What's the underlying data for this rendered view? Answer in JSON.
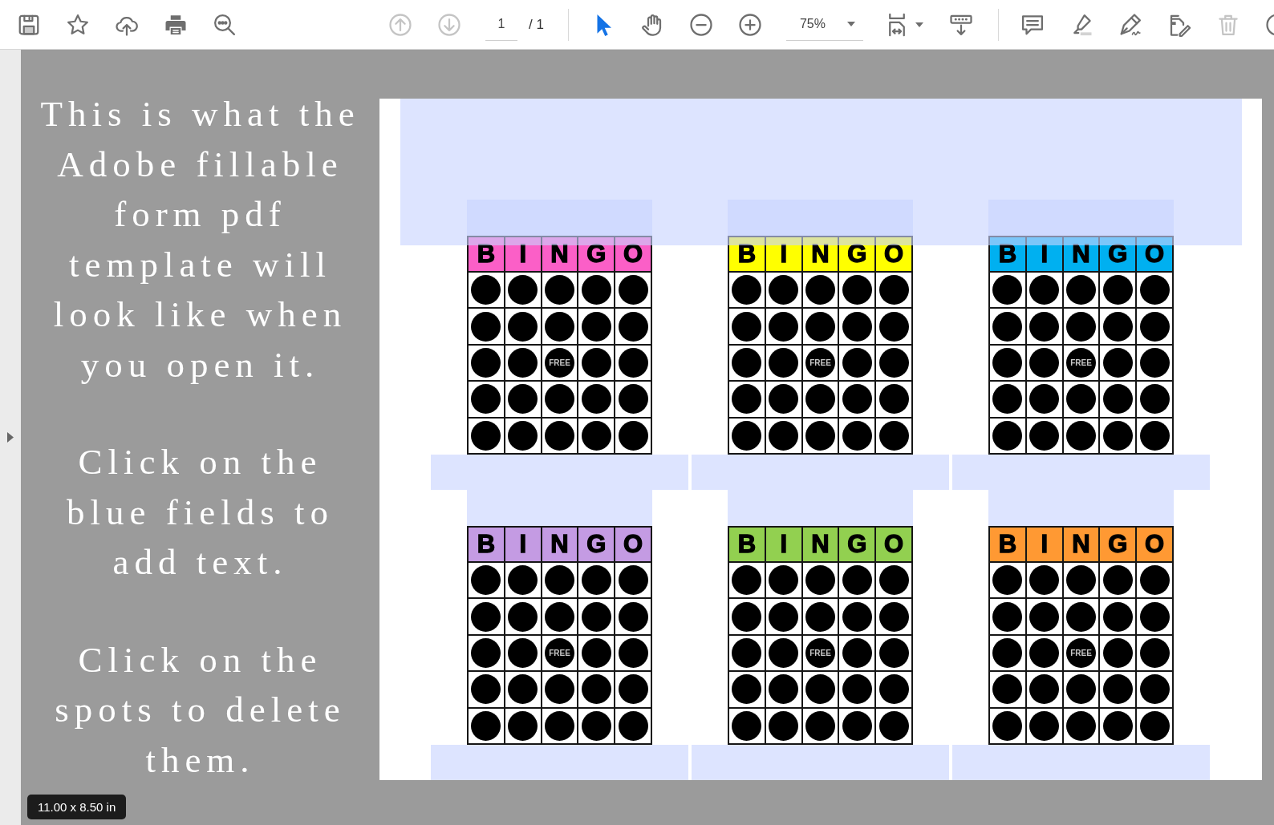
{
  "toolbar": {
    "page_nav": [
      {
        "disabled": true
      },
      {
        "disabled": true
      }
    ],
    "page_field": {
      "value": "1"
    },
    "page_count": "/ 1",
    "tools": [
      {
        "selected": true
      },
      {
        "selected": false
      }
    ],
    "zoom_field": {
      "value": "75%"
    },
    "annotate_tools": [
      {
        "disabled": false
      },
      {
        "disabled": false
      },
      {
        "disabled": false
      },
      {
        "disabled": false
      },
      {
        "disabled": true
      }
    ]
  },
  "instructions": [
    {
      "lines": [
        "This is what the",
        "Adobe fillable",
        "form pdf",
        "template will",
        "look like when",
        "you open it."
      ]
    },
    {
      "lines": [
        "Click on the",
        "blue fields to",
        "add text."
      ]
    },
    {
      "lines": [
        "Click on the",
        "spots to delete",
        "them."
      ]
    }
  ],
  "page": {
    "cards": [
      {
        "color": "#fb5fc7",
        "letters": [
          "B",
          "I",
          "N",
          "G",
          "O"
        ],
        "free_label": "FREE"
      },
      {
        "color": "#ffff00",
        "letters": [
          "B",
          "I",
          "N",
          "G",
          "O"
        ],
        "free_label": "FREE"
      },
      {
        "color": "#00b0f0",
        "letters": [
          "B",
          "I",
          "N",
          "G",
          "O"
        ],
        "free_label": "FREE"
      },
      {
        "color": "#c49be3",
        "letters": [
          "B",
          "I",
          "N",
          "G",
          "O"
        ],
        "free_label": "FREE"
      },
      {
        "color": "#92d050",
        "letters": [
          "B",
          "I",
          "N",
          "G",
          "O"
        ],
        "free_label": "FREE"
      },
      {
        "color": "#ff9933",
        "letters": [
          "B",
          "I",
          "N",
          "G",
          "O"
        ],
        "free_label": "FREE"
      }
    ]
  },
  "page_size": "11.00 x 8.50 in"
}
